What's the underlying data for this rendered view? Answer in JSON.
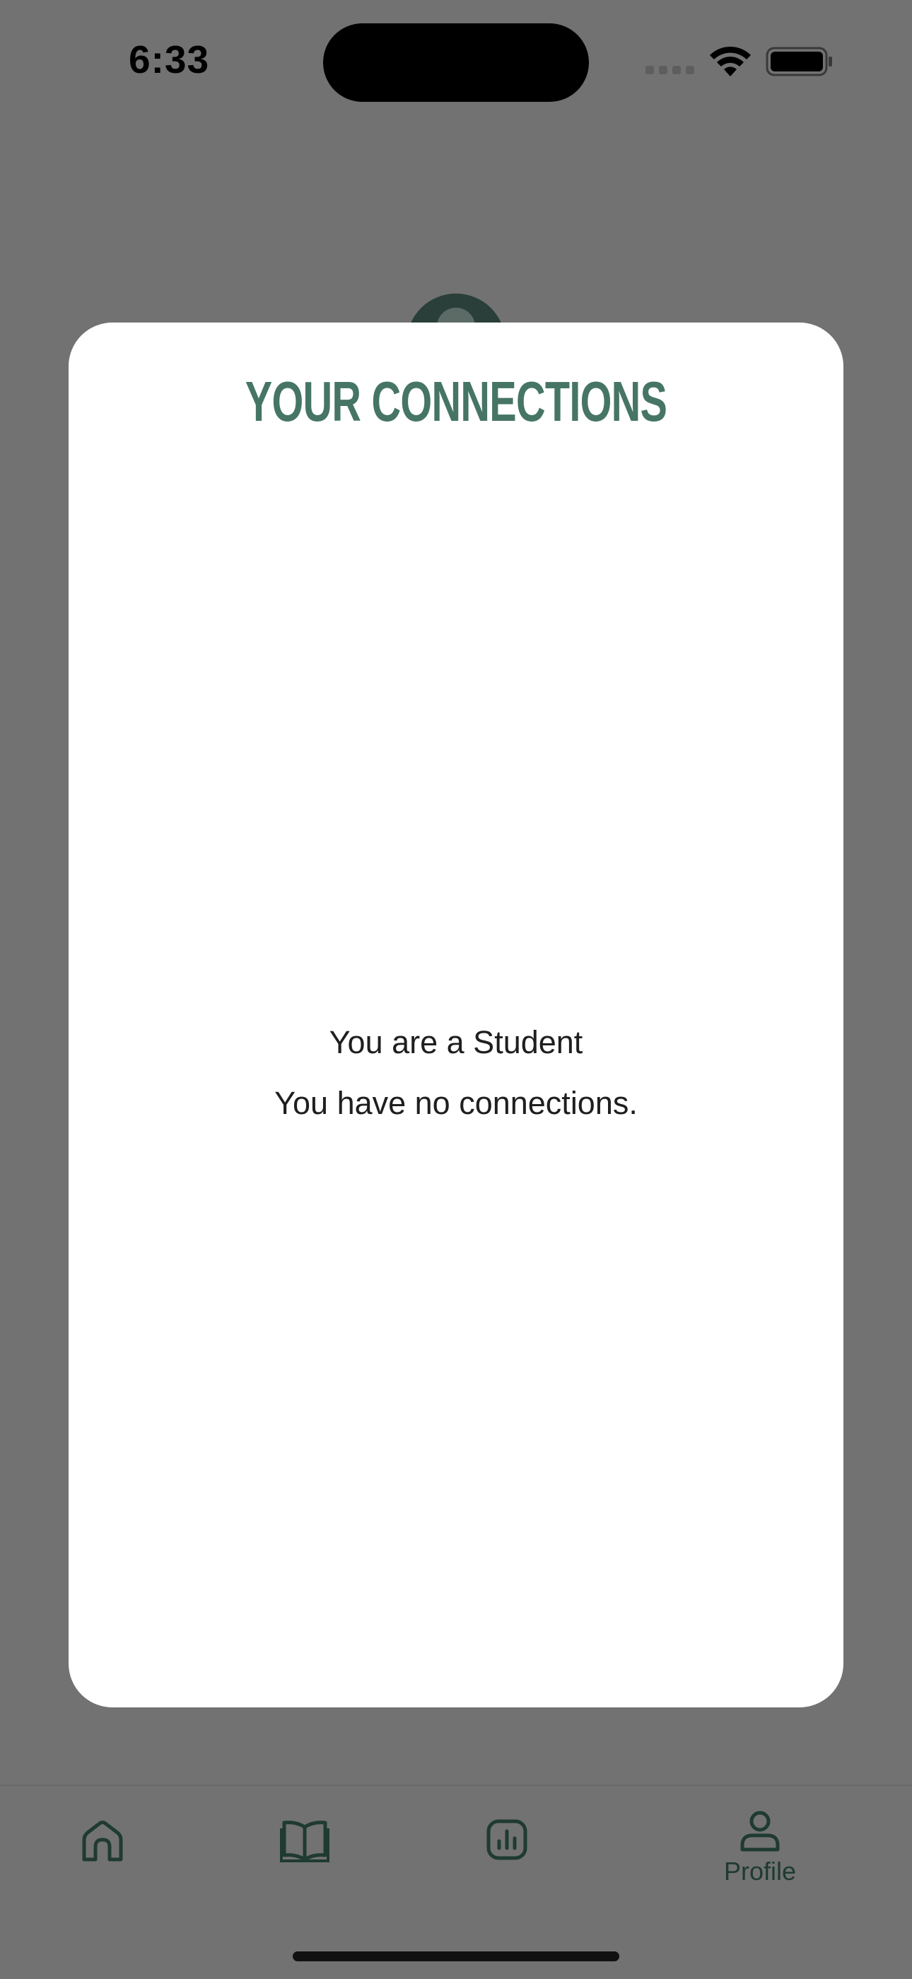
{
  "status_bar": {
    "time": "6:33"
  },
  "modal": {
    "title": "YOUR CONNECTIONS",
    "role_text": "You are a Student",
    "empty_text": "You have no connections."
  },
  "tab_bar": {
    "tabs": [
      {
        "icon": "home-icon",
        "label": ""
      },
      {
        "icon": "book-icon",
        "label": ""
      },
      {
        "icon": "stats-icon",
        "label": ""
      },
      {
        "icon": "person-icon",
        "label": "Profile",
        "selected": true
      }
    ]
  },
  "colors": {
    "overlay_background": "#727272",
    "accent_green": "#467565",
    "tab_icon_dark": "#1f3a32",
    "modal_background": "#ffffff"
  }
}
